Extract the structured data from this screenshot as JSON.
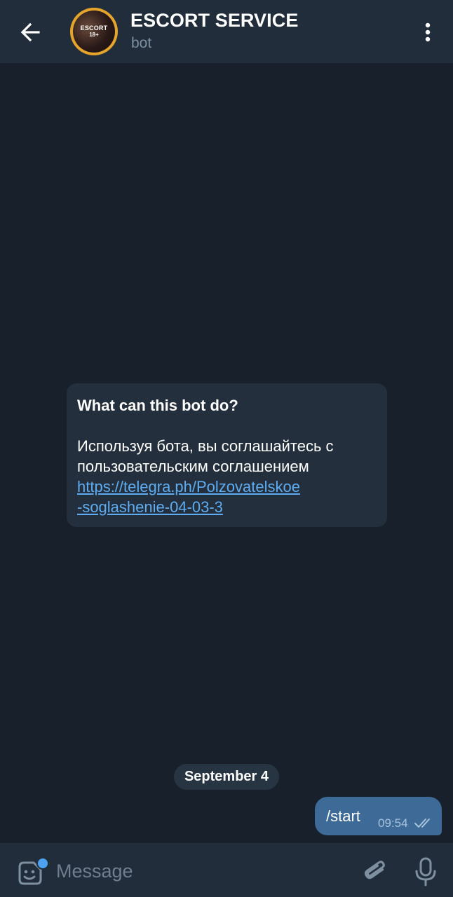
{
  "header": {
    "title": "ESCORT SERVICE",
    "subtitle": "bot",
    "avatar_text_line1": "ESCORT",
    "avatar_text_line2": "18+"
  },
  "bot_info": {
    "title": "What can this bot do?",
    "description": "Используя бота, вы соглашайтесь с пользовательским соглашением",
    "link_line1": "https://telegra.ph/Polzovatelskoe",
    "link_line2": "-soglashenie-04-03-3"
  },
  "messages": [
    {
      "date_label": "September 4"
    },
    {
      "text": "/start",
      "time": "09:54",
      "status": "read-double-check",
      "outgoing": true
    }
  ],
  "composer": {
    "placeholder": "Message"
  },
  "icons": [
    "back-arrow-icon",
    "more-vertical-icon",
    "sticker-icon",
    "attach-icon",
    "microphone-icon",
    "double-check-icon"
  ],
  "colors": {
    "background": "#18202b",
    "header": "#212d3b",
    "bubble_incoming": "#232f3c",
    "bubble_outgoing": "#3d6a97",
    "link": "#5eadf2",
    "accent_dot": "#4da2f0"
  }
}
